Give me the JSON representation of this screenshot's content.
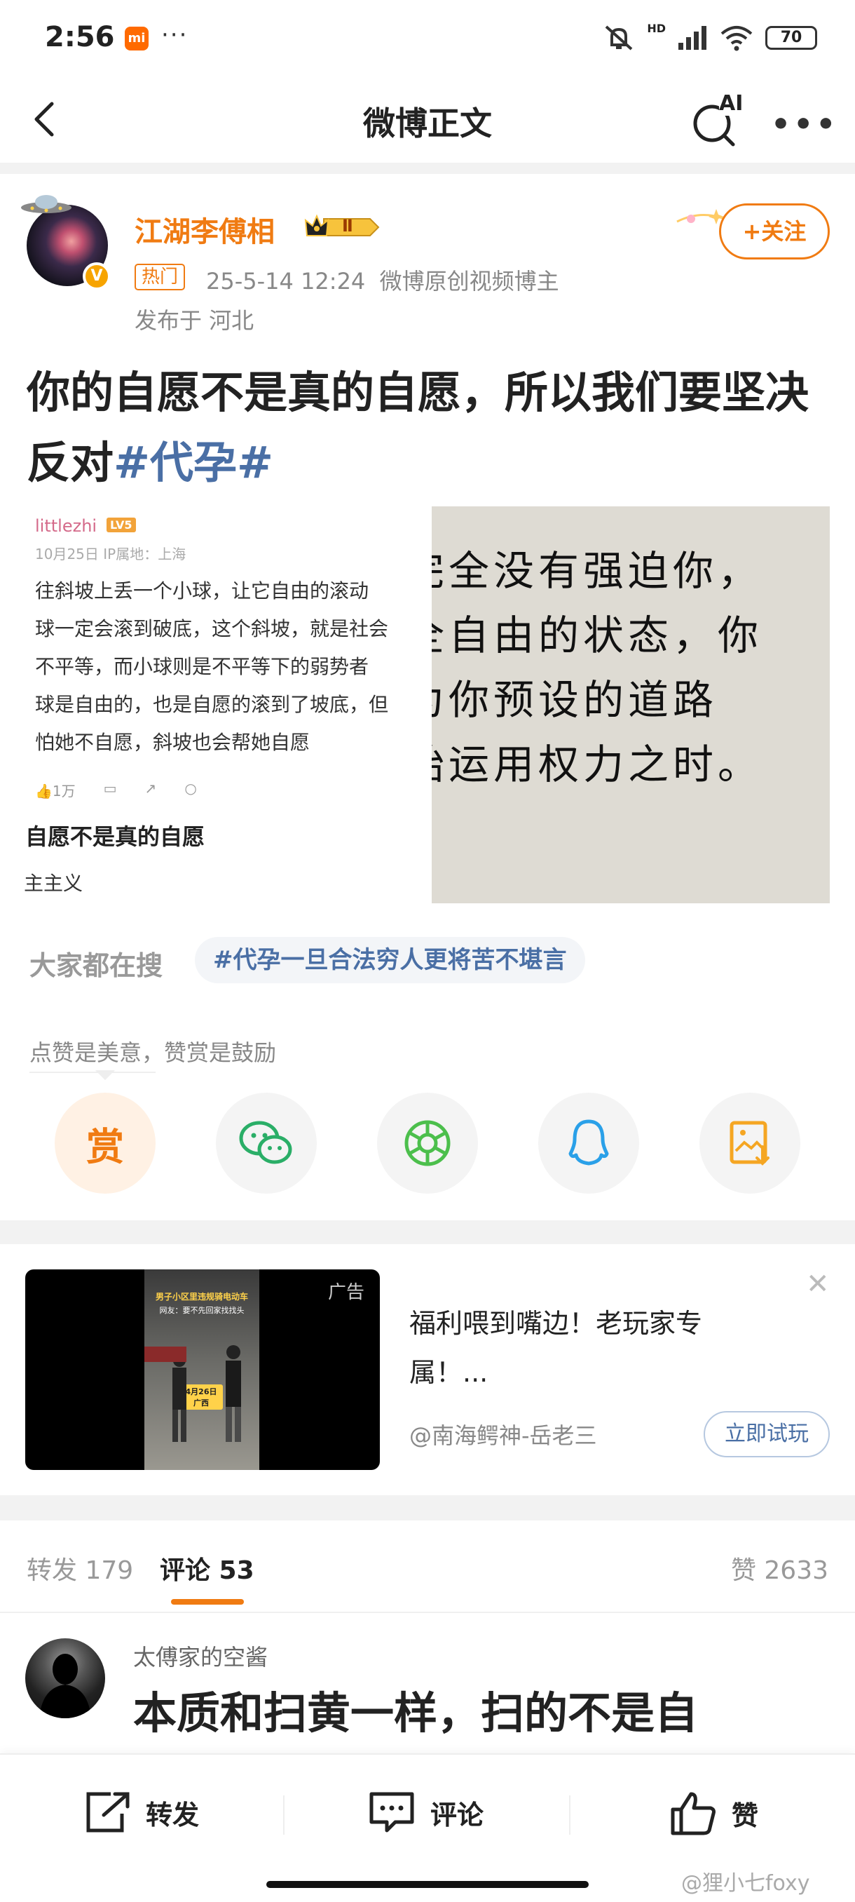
{
  "status_bar": {
    "time": "2:56",
    "mi_badge": "mi",
    "dots": "···",
    "network": "HD",
    "battery": "70"
  },
  "nav": {
    "title": "微博正文",
    "ai_label": "AI"
  },
  "author": {
    "name": "江湖李傅相",
    "level_badge": "Ⅱ",
    "hot_tag": "热门",
    "meta": "25-5-14 12:24  微博原创视频博主",
    "location": "发布于 河北",
    "follow_label": "+关注",
    "verified": "V"
  },
  "post": {
    "text_plain": "你的自愿不是真的自愿，所以我们要坚决反对",
    "hashtag": "#代孕#"
  },
  "image_left": {
    "user": "littlezhi",
    "level": "LV5",
    "date": "10月25日  IP属地：上海",
    "body": "往斜坡上丢一个小球，让它自由的滚动\n球一定会滚到破底，这个斜坡，就是社会\n不平等，而小球则是不平等下的弱势者\n球是自由的，也是自愿的滚到了坡底，但\n怕她不自愿，斜坡也会帮她自愿",
    "likes": "1万",
    "caption": "自愿不是真的自愿",
    "tag": "主主义"
  },
  "image_right": {
    "text": "完全没有强迫你，\n全自由的状态，你\n为你预设的道路\n始运用权力之时。"
  },
  "search": {
    "label": "大家都在搜",
    "chip": "#代孕一旦合法穷人更将苦不堪言"
  },
  "reward_tip": "点赞是美意，赞赏是鼓励",
  "share": {
    "reward_label": "赏"
  },
  "ad": {
    "label": "广告",
    "title": "福利喂到嘴边！老玩家专属！...",
    "source": "@南海鳄神-岳老三",
    "button": "立即试玩",
    "close": "✕",
    "video_caption": "男子小区里违规骑电动车",
    "video_sub": "网友：要不先回家找找头",
    "video_date": "4月26日 广西"
  },
  "tabs": {
    "repost": "转发 179",
    "comment": "评论 53",
    "like": "赞 2633"
  },
  "comment": {
    "user": "太傅家的空酱",
    "text": "本质和扫黄一样，扫的不是自"
  },
  "bottom_bar": {
    "repost": "转发",
    "comment": "评论",
    "like": "赞"
  },
  "watermark": "@狸小七foxy",
  "colors": {
    "accent": "#f07b12",
    "link": "#4a6fa5",
    "muted": "#888888"
  }
}
